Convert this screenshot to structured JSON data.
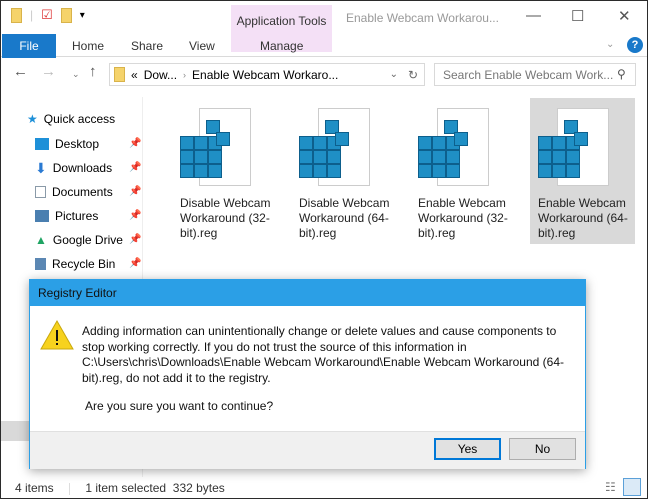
{
  "window": {
    "title": "Enable Webcam Workarou...",
    "context_tab": "Application Tools"
  },
  "ribbon": {
    "file": "File",
    "tabs": [
      "Home",
      "Share",
      "View"
    ],
    "manage": "Manage"
  },
  "address": {
    "overflow": "«",
    "crumbs": [
      "Dow...",
      "Enable Webcam Workaro..."
    ]
  },
  "search": {
    "placeholder": "Search Enable Webcam Work..."
  },
  "sidebar": {
    "quick_access": "Quick access",
    "items": [
      {
        "label": "Desktop",
        "color": "#1e90d8"
      },
      {
        "label": "Downloads",
        "color": "#2a7ad2"
      },
      {
        "label": "Documents",
        "color": "#8a9aa8"
      },
      {
        "label": "Pictures",
        "color": "#4a7fb0"
      },
      {
        "label": "Google Drive",
        "color": "#1fa463"
      },
      {
        "label": "Recycle Bin",
        "color": "#5b87b3"
      }
    ]
  },
  "files": [
    {
      "name": "Disable Webcam Workaround (32-bit).reg"
    },
    {
      "name": "Disable Webcam Workaround (64-bit).reg"
    },
    {
      "name": "Enable Webcam Workaround (32-bit).reg"
    },
    {
      "name": "Enable Webcam Workaround (64-bit).reg",
      "selected": true
    }
  ],
  "dialog": {
    "title": "Registry Editor",
    "message": "Adding information can unintentionally change or delete values and cause components to stop working correctly. If you do not trust the source of this information in C:\\Users\\chris\\Downloads\\Enable Webcam Workaround\\Enable Webcam Workaround (64-bit).reg, do not add it to the registry.",
    "question": "Are you sure you want to continue?",
    "yes": "Yes",
    "no": "No"
  },
  "status": {
    "items": "4 items",
    "selected": "1 item selected",
    "size": "332 bytes"
  }
}
